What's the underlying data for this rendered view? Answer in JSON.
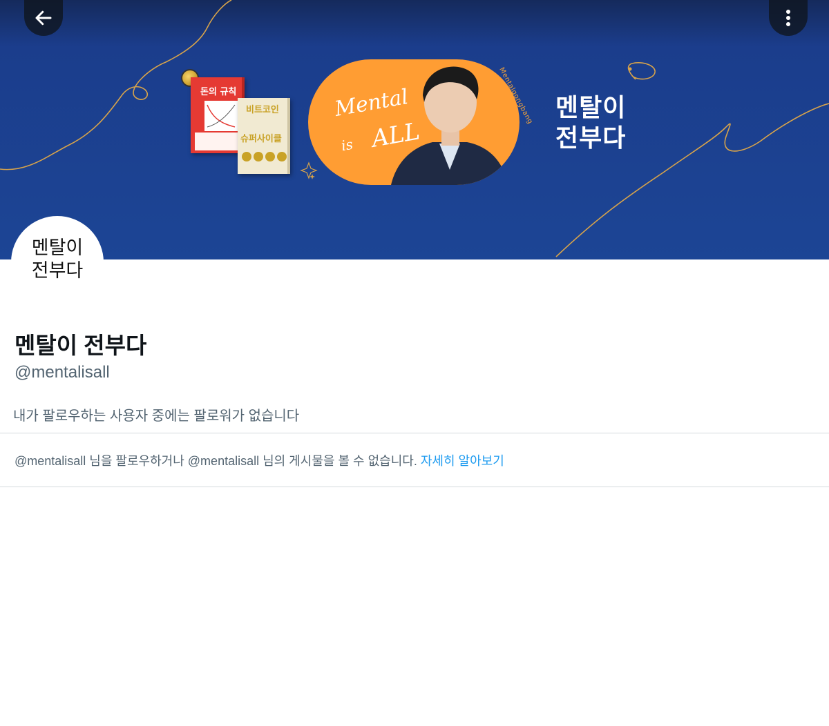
{
  "banner": {
    "title_line1": "멘탈이",
    "title_line2": "전부다",
    "book1_title": "돈의 규칙",
    "book2_title": "비트코인",
    "book2_subtitle": "슈퍼사이클",
    "script_mental": "Mental",
    "script_is": "is",
    "script_all": "ALL",
    "side_text": "Mentalgongbang",
    "colors": {
      "background": "#1c4595",
      "accent": "#ff9d33"
    }
  },
  "nav": {
    "back_icon": "arrow-left-icon",
    "more_icon": "more-vertical-icon"
  },
  "avatar": {
    "line1": "멘탈이",
    "line2": "전부다"
  },
  "profile": {
    "name": "멘탈이 전부다",
    "handle": "@mentalisall",
    "followers_note": "내가 팔로우하는 사용자 중에는 팔로워가 없습니다"
  },
  "blocked_notice": {
    "text": "@mentalisall 님을 팔로우하거나 @mentalisall 님의 게시물을 볼 수 없습니다. ",
    "link": "자세히 알아보기"
  }
}
